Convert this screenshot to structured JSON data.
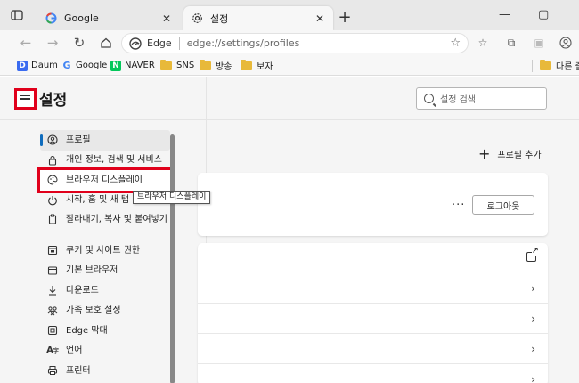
{
  "tabs": [
    {
      "title": "Google",
      "icon": "google-icon"
    },
    {
      "title": "설정",
      "icon": "gear-icon"
    }
  ],
  "toolbar": {
    "address_label": "Edge",
    "address_url": "edge://settings/profiles"
  },
  "favorites": [
    {
      "label": "Daum",
      "icon": "daum-icon"
    },
    {
      "label": "Google",
      "icon": "google-icon"
    },
    {
      "label": "NAVER",
      "icon": "naver-icon"
    },
    {
      "label": "SNS",
      "icon": "folder-icon"
    },
    {
      "label": "방송",
      "icon": "folder-icon"
    },
    {
      "label": "보자",
      "icon": "folder-icon"
    },
    {
      "label": "다른 즐",
      "icon": "folder-icon"
    }
  ],
  "settings": {
    "title": "설정",
    "search_placeholder": "설정 검색",
    "menu": [
      {
        "label": "프로필",
        "icon": "profile-icon"
      },
      {
        "label": "개인 정보, 검색 및 서비스",
        "icon": "lock-icon"
      },
      {
        "label": "브라우저 디스플레이",
        "icon": "palette-icon"
      },
      {
        "label": "시작, 홈 및 새 탭",
        "icon": "power-icon"
      },
      {
        "label": "잘라내기, 복사 및 붙여넣기",
        "icon": "clipboard-icon"
      },
      {
        "label": "쿠키 및 사이트 권한",
        "icon": "site-permissions-icon"
      },
      {
        "label": "기본 브라우저",
        "icon": "browser-icon"
      },
      {
        "label": "다운로드",
        "icon": "download-icon"
      },
      {
        "label": "가족 보호 설정",
        "icon": "family-icon"
      },
      {
        "label": "Edge 막대",
        "icon": "edge-bar-icon"
      },
      {
        "label": "언어",
        "icon": "language-icon"
      },
      {
        "label": "프린터",
        "icon": "printer-icon"
      }
    ],
    "tooltip": "브라우저 디스플레이",
    "add_profile": "프로필 추가",
    "logout": "로그아웃"
  }
}
